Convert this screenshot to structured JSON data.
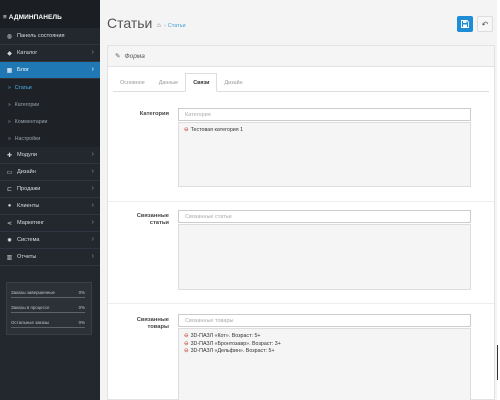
{
  "sidebar": {
    "header": "≡ АДМИНПАНЕЛЬ",
    "items": [
      {
        "icon": "dashboard-icon",
        "glyph": "◍",
        "label": "Панель состояния",
        "chevron": ""
      },
      {
        "icon": "tag-icon",
        "glyph": "◆",
        "label": "Каталог",
        "chevron": "›"
      },
      {
        "icon": "blog-icon",
        "glyph": "▦",
        "label": "Блог",
        "chevron": "›",
        "active": true
      }
    ],
    "subitems": [
      "Статьи",
      "Категории",
      "Комментарии",
      "Настройки"
    ],
    "items2": [
      {
        "icon": "puzzle-icon",
        "glyph": "✚",
        "label": "Модули",
        "chevron": "›"
      },
      {
        "icon": "monitor-icon",
        "glyph": "▭",
        "label": "Дизайн",
        "chevron": "›"
      },
      {
        "icon": "cart-icon",
        "glyph": "⊏",
        "label": "Продажи",
        "chevron": "›"
      },
      {
        "icon": "user-icon",
        "glyph": "●",
        "label": "Клиенты",
        "chevron": "›"
      },
      {
        "icon": "share-icon",
        "glyph": "⋖",
        "label": "Маркетинг",
        "chevron": "›"
      },
      {
        "icon": "gear-icon",
        "glyph": "✹",
        "label": "Система",
        "chevron": "›"
      },
      {
        "icon": "chart-icon",
        "glyph": "▥",
        "label": "Отчеты",
        "chevron": "›"
      }
    ],
    "stats": [
      {
        "label": "Заказы завершенные",
        "value": "0%",
        "progress": 0
      },
      {
        "label": "Заказы в процессе",
        "value": "0%",
        "progress": 0
      },
      {
        "label": "Остальные заказы",
        "value": "0%",
        "progress": 0
      }
    ]
  },
  "header": {
    "title": "Статьи",
    "breadcrumb": "Статьи",
    "save_icon": "save-icon",
    "back_icon": "reply-icon"
  },
  "panel": {
    "title": "Форма",
    "tabs": [
      "Основное",
      "Данные",
      "Связи",
      "Дизайн"
    ],
    "active_tab": "Связи"
  },
  "form": {
    "category": {
      "label": "Категория",
      "placeholder": "Категория",
      "items": [
        "Тестовая категория 1"
      ]
    },
    "related_articles": {
      "label_line1": "Связанные",
      "label_line2": "статьи",
      "placeholder": "Связанные статьи",
      "items": []
    },
    "related_products": {
      "label_line1": "Связанные",
      "label_line2": "товары",
      "placeholder": "Связанные товары",
      "items": [
        "3D-ПАЗЛ «Кот». Возраст: 5+",
        "3D-ПАЗЛ «Бронтозавр». Возраст: 3+",
        "3D-ПАЗЛ «Дельфин». Возраст: 5+"
      ]
    }
  },
  "colors": {
    "sidebar_bg": "#23282e",
    "active_blue": "#1f78b4",
    "save_blue": "#1f8cd6",
    "link_blue": "#4aa0d8",
    "remove_red": "#c0392b"
  }
}
